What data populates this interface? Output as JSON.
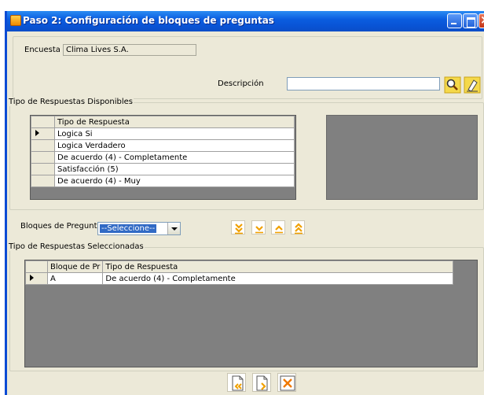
{
  "window": {
    "title": "Paso 2: Configuración de bloques de preguntas",
    "app_icon": "app-icon"
  },
  "header": {
    "encuesta_label": "Encuesta",
    "encuesta_value": "Clima Lives S.A.",
    "descripcion_label": "Descripción",
    "descripcion_value": "",
    "search_icon": "search-icon",
    "clear_icon": "eraser-icon"
  },
  "available": {
    "legend": "Tipo de Respuestas Disponibles",
    "column": "Tipo de Respuesta",
    "rows": [
      "Logica Si",
      "Logica Verdadero",
      "De acuerdo (4) - Completamente",
      "Satisfacción (5)",
      "De acuerdo (4) - Muy"
    ],
    "current_row": 0
  },
  "bloques": {
    "label": "Bloques de Pregunta",
    "selected": "--Seleccione--"
  },
  "move_buttons": [
    "move-all-down-icon",
    "move-down-icon",
    "move-up-icon",
    "move-all-up-icon"
  ],
  "selected": {
    "legend": "Tipo de Respuestas Seleccionadas",
    "columns": [
      "Bloque de Pr",
      "Tipo de Respuesta"
    ],
    "rows": [
      [
        "A",
        "De acuerdo (4) - Completamente"
      ]
    ],
    "current_row": 0
  },
  "footer": {
    "buttons": [
      "previous-page-icon",
      "next-page-icon",
      "cancel-icon"
    ]
  },
  "colors": {
    "title_bar": "#0954d6",
    "window_bg": "#ece9d8",
    "grid_empty": "#808080",
    "accent_orange": "#f0a000"
  }
}
